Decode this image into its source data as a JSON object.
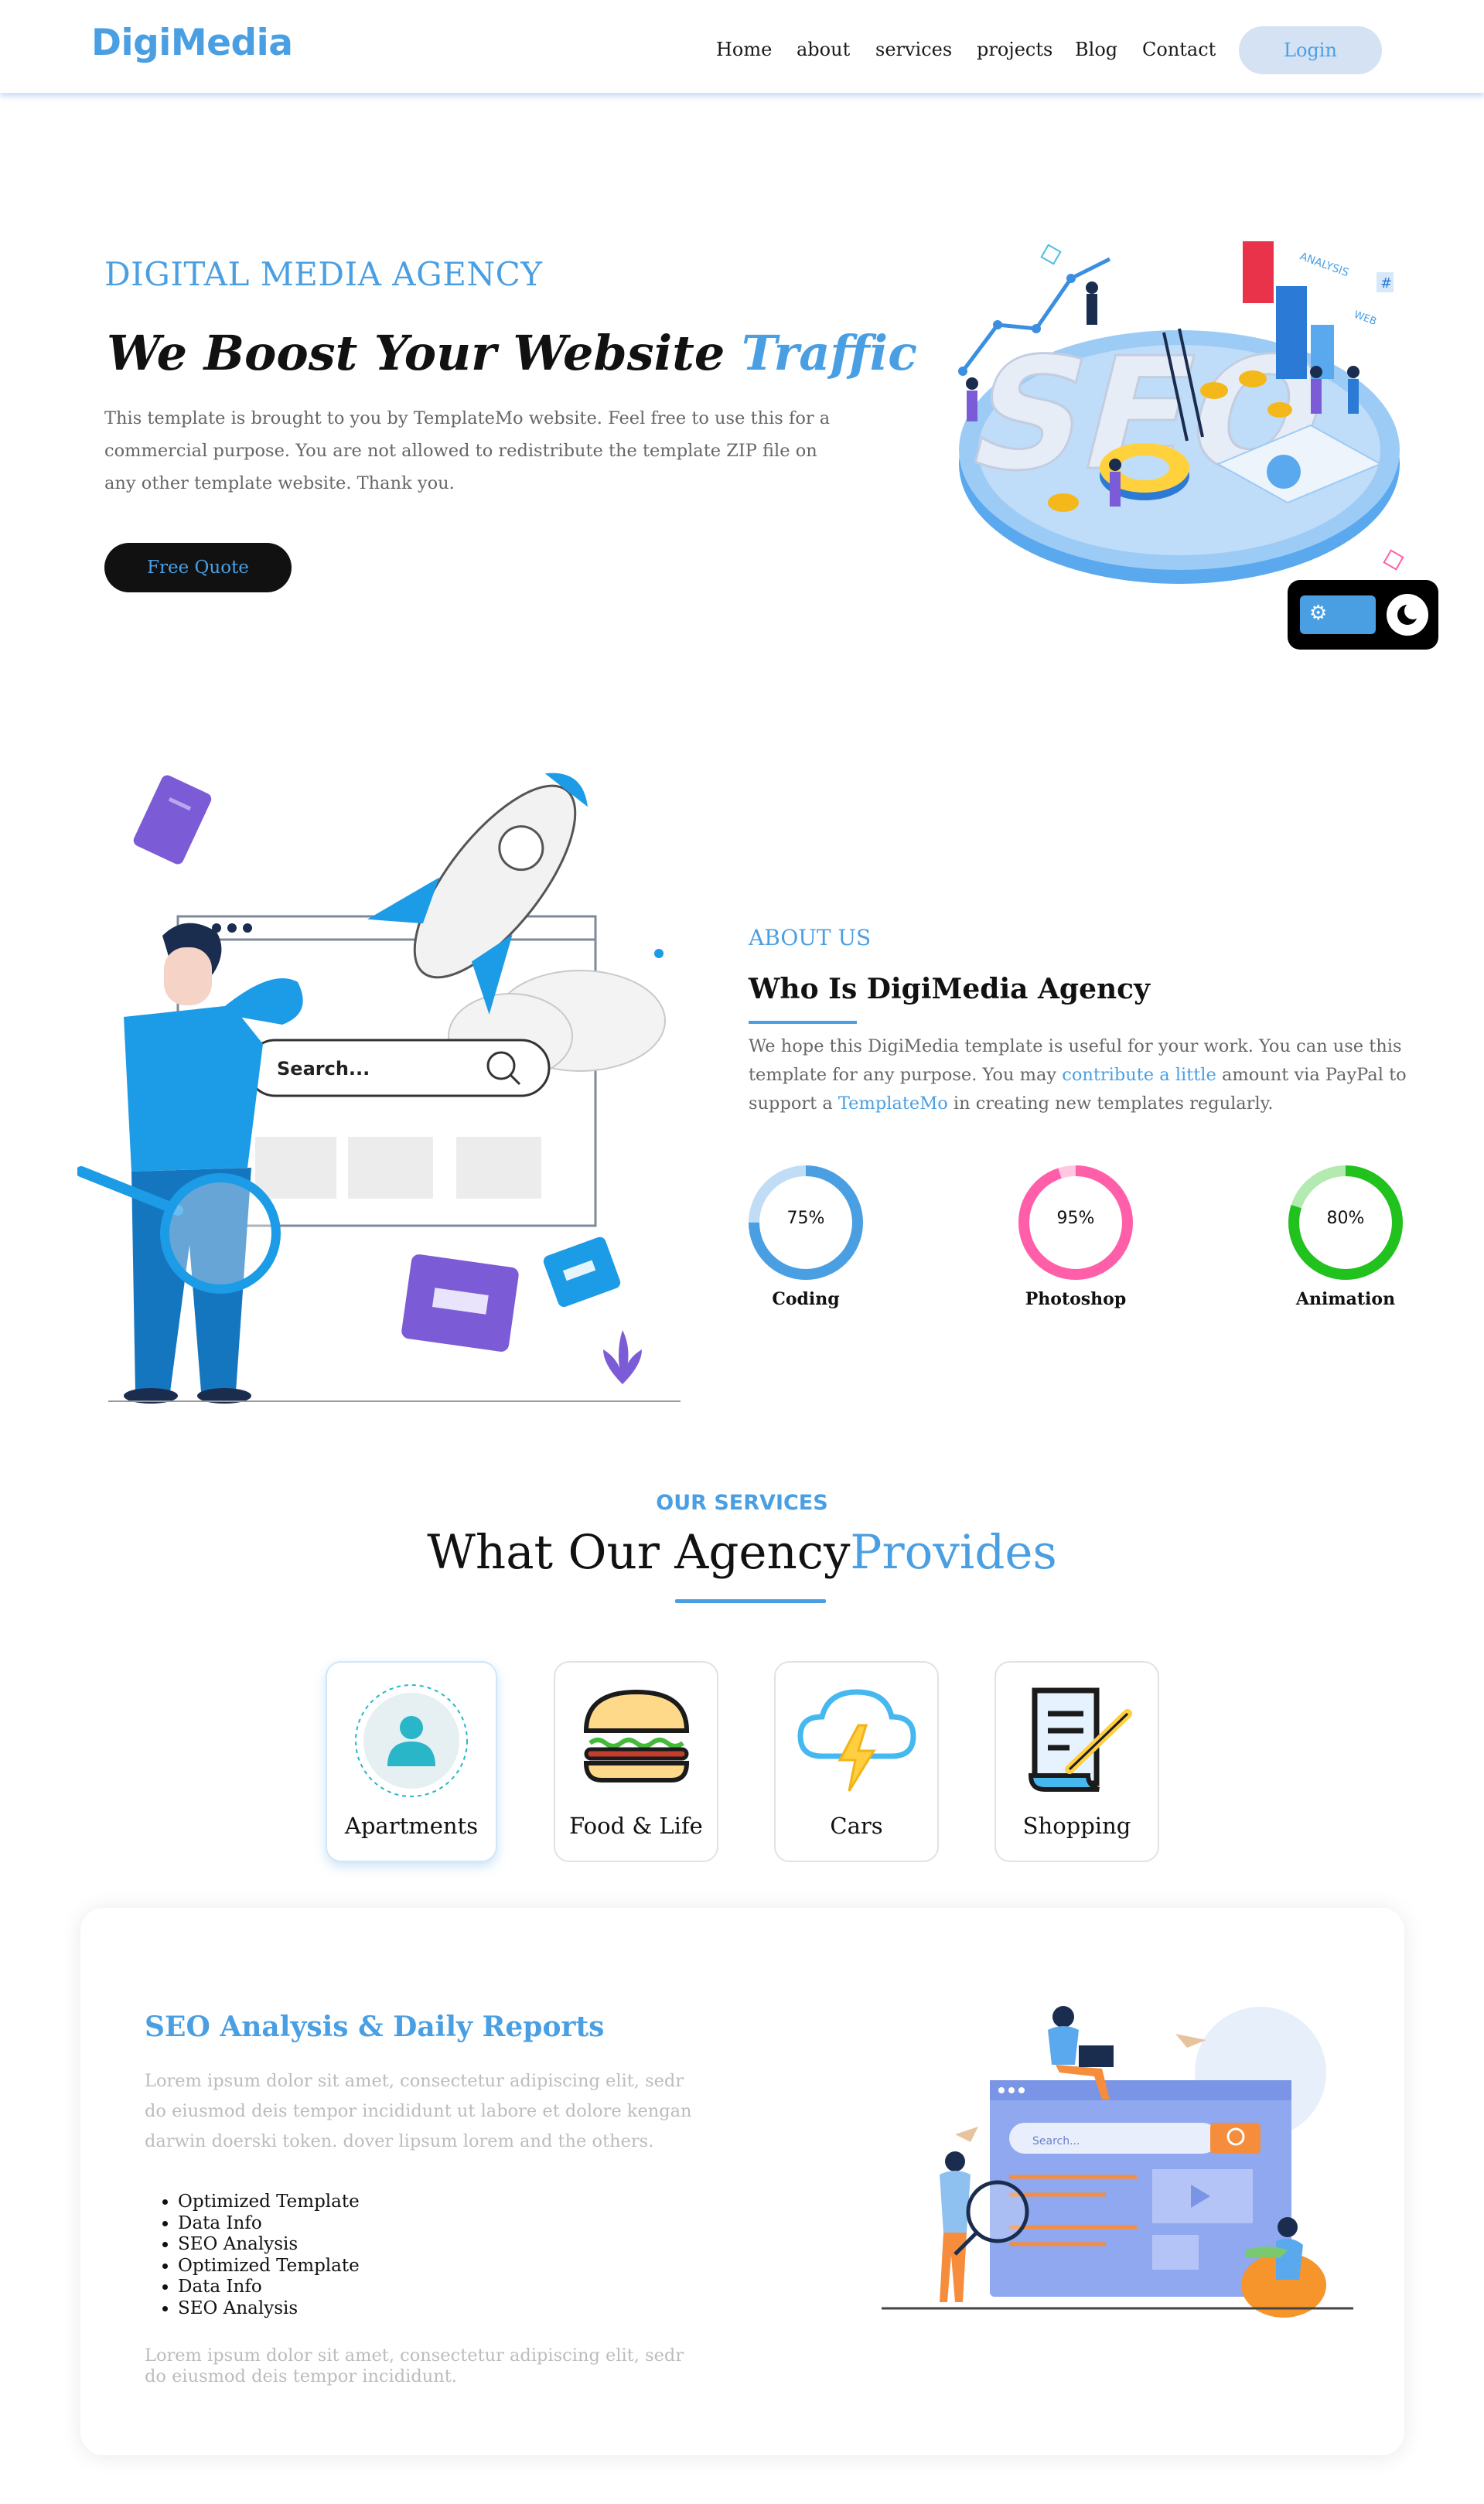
{
  "header": {
    "logo": "DigiMedia",
    "nav": [
      "Home",
      "about",
      "services",
      "projects",
      "Blog",
      "Contact"
    ],
    "login_label": "Login"
  },
  "hero": {
    "eyebrow": "DIGITAL MEDIA AGENCY",
    "title_main": "We Boost Your Website ",
    "title_accent": "Traffic",
    "description": "This template is brought to you by TemplateMo website. Feel free to use this for a commercial purpose. You are not allowed to redistribute the template ZIP file on any other template website. Thank you.",
    "cta_label": "Free Quote",
    "illustration_words": [
      "SEO",
      "ANALYSIS",
      "#",
      "WEB"
    ]
  },
  "about": {
    "eyebrow": "ABOUT US",
    "title": "Who Is DigiMedia Agency",
    "text_before_link1": "We hope this DigiMedia template is useful for your work. You can use this template for any purpose. You may ",
    "link1": "contribute a little",
    "text_between": " amount via PayPal to support a ",
    "link2": "TemplateMo",
    "text_after": " in creating new templates regularly.",
    "search_placeholder": "Search...",
    "skills": [
      {
        "label": "Coding",
        "percent": 75,
        "display": "75%",
        "color": "#4a9fe3"
      },
      {
        "label": "Photoshop",
        "percent": 95,
        "display": "95%",
        "color": "#ff5fa8"
      },
      {
        "label": "Animation",
        "percent": 80,
        "display": "80%",
        "color": "#22c21e"
      }
    ]
  },
  "services": {
    "eyebrow": "OUR SERVICES",
    "title_main": "What Our Agency",
    "title_accent": "Provides",
    "tabs": [
      {
        "label": "Apartments",
        "icon": "user-icon",
        "active": true
      },
      {
        "label": "Food & Life",
        "icon": "burger-icon",
        "active": false
      },
      {
        "label": "Cars",
        "icon": "cloud-lightning-icon",
        "active": false
      },
      {
        "label": "Shopping",
        "icon": "document-pen-icon",
        "active": false
      }
    ],
    "card": {
      "title": "SEO Analysis & Daily Reports",
      "paragraph1": "Lorem ipsum dolor sit amet, consectetur adipiscing elit, sedr do eiusmod deis tempor incididunt ut labore et dolore kengan darwin doerski token. dover lipsum lorem and the others.",
      "list": [
        "Optimized Template",
        "Data Info",
        "SEO Analysis",
        "Optimized Template",
        "Data Info",
        "SEO Analysis"
      ],
      "paragraph2": "Lorem ipsum dolor sit amet, consectetur adipiscing elit, sedr do eiusmod deis tempor incididunt.",
      "search_placeholder": "Search..."
    }
  },
  "colors": {
    "accent": "#4a9fe3",
    "dark": "#111111",
    "muted": "#666666"
  }
}
